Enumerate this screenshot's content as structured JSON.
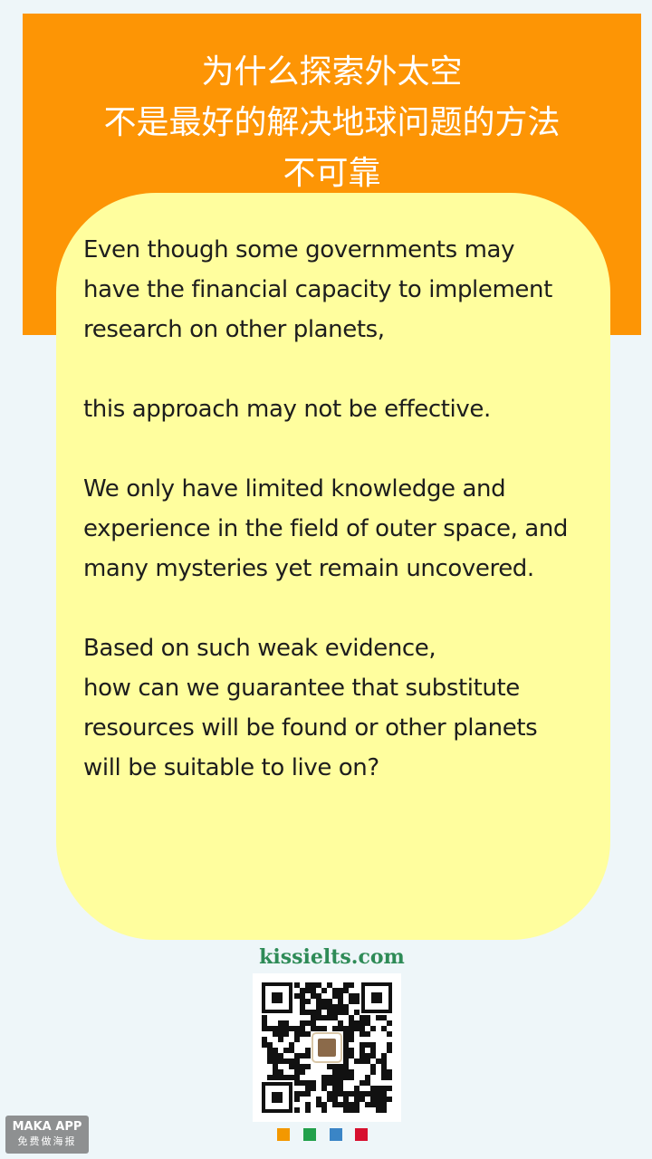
{
  "title": {
    "line1": "为什么探索外太空",
    "line2": "不是最好的解决地球问题的方法",
    "line3": "不可靠"
  },
  "body": {
    "lines": [
      "Even though some governments may",
      "have the financial capacity to implement",
      "research on other planets,",
      "",
      "this approach may not be effective.",
      "",
      "We only have limited knowledge and",
      "experience in the field of outer space, and",
      "many mysteries yet remain uncovered.",
      "",
      "Based on such weak evidence,",
      "how can we guarantee that substitute",
      "resources will be found or other planets",
      "will be suitable to live on?"
    ]
  },
  "footer": {
    "site": "kissielts.com",
    "qr_icon": "qr-code-icon"
  },
  "badge": {
    "line1": "MAKA APP",
    "line2": "免费做海报"
  },
  "colors": {
    "header": "#fd9505",
    "card": "#fffe9e",
    "background": "#eef6f9",
    "site_text": "#2e8b57",
    "dots": [
      "#f39800",
      "#22a04b",
      "#3a85c6",
      "#d7102f"
    ]
  }
}
